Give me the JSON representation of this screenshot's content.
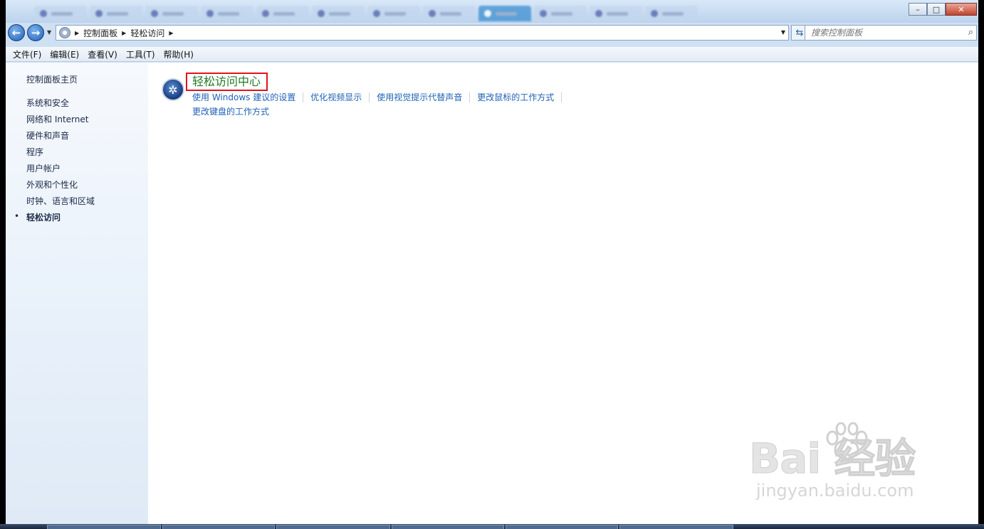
{
  "window": {
    "controls": {
      "minimize": "–",
      "maximize": "□",
      "close": "✕"
    }
  },
  "address": {
    "breadcrumbs": [
      "控制面板",
      "轻松访问"
    ],
    "refresh_icon": "refresh-icon"
  },
  "search": {
    "placeholder": "搜索控制面板"
  },
  "menu": [
    "文件(F)",
    "编辑(E)",
    "查看(V)",
    "工具(T)",
    "帮助(H)"
  ],
  "sidebar": {
    "home": "控制面板主页",
    "items": [
      {
        "label": "系统和安全",
        "current": false
      },
      {
        "label": "网络和 Internet",
        "current": false
      },
      {
        "label": "硬件和声音",
        "current": false
      },
      {
        "label": "程序",
        "current": false
      },
      {
        "label": "用户帐户",
        "current": false
      },
      {
        "label": "外观和个性化",
        "current": false
      },
      {
        "label": "时钟、语言和区域",
        "current": false
      },
      {
        "label": "轻松访问",
        "current": true
      }
    ],
    "bullet": "•"
  },
  "main": {
    "category_title": "轻松访问中心",
    "tasks_row1": [
      "使用 Windows 建议的设置",
      "优化视频显示",
      "使用视觉提示代替声音",
      "更改鼠标的工作方式"
    ],
    "tasks_row2": [
      "更改键盘的工作方式"
    ]
  },
  "watermark": {
    "main": "Bai  经验",
    "sub": "jingyan.baidu.com"
  },
  "colors": {
    "link": "#1e61b6",
    "category_title": "#1f7a25",
    "highlight_box": "#e0141a"
  }
}
